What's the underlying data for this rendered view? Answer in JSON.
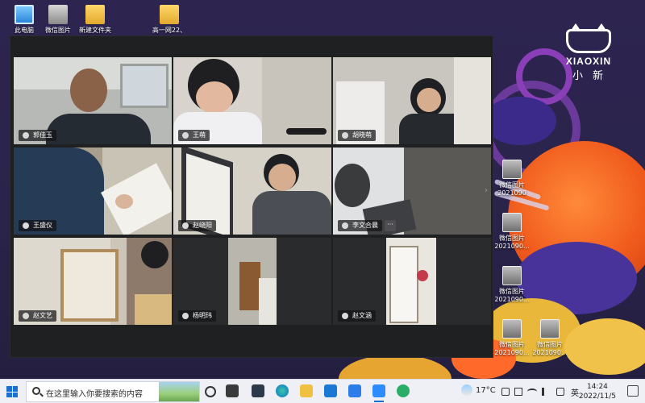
{
  "desktop": {
    "icons": [
      {
        "label": "此电脑",
        "icon": "pc-icon"
      },
      {
        "label": "微信图片",
        "icon": "photo-icon"
      },
      {
        "label": "新建文件夹",
        "icon": "folder-icon"
      },
      {
        "label": "高一网22、",
        "icon": "folder-icon"
      }
    ],
    "right_icons": [
      {
        "line1": "微信图片",
        "line2": "2021090"
      },
      {
        "line1": "微信图片",
        "line2": "2021090..."
      },
      {
        "line1": "微信图片",
        "line2": "2021090..."
      },
      {
        "line1": "微信图片",
        "line2": "2021090..."
      },
      {
        "line1": "微信图片",
        "line2": "2021090..."
      }
    ],
    "brand": {
      "name": "XIAOXIN",
      "cn": "小新"
    }
  },
  "meeting": {
    "participants": [
      {
        "name": "郭佳玉"
      },
      {
        "name": "王萌"
      },
      {
        "name": "胡晓萌"
      },
      {
        "name": "王盛仪"
      },
      {
        "name": "赵峣阳"
      },
      {
        "name": "李文合晨"
      },
      {
        "name": "赵文艺"
      },
      {
        "name": "杨明玮"
      },
      {
        "name": "赵文涵"
      }
    ],
    "more_label": "···"
  },
  "taskbar": {
    "search_placeholder": "在这里输入你要搜索的内容",
    "weather": "17°C",
    "ime": "英",
    "time": "14:24",
    "date": "2022/11/5"
  }
}
